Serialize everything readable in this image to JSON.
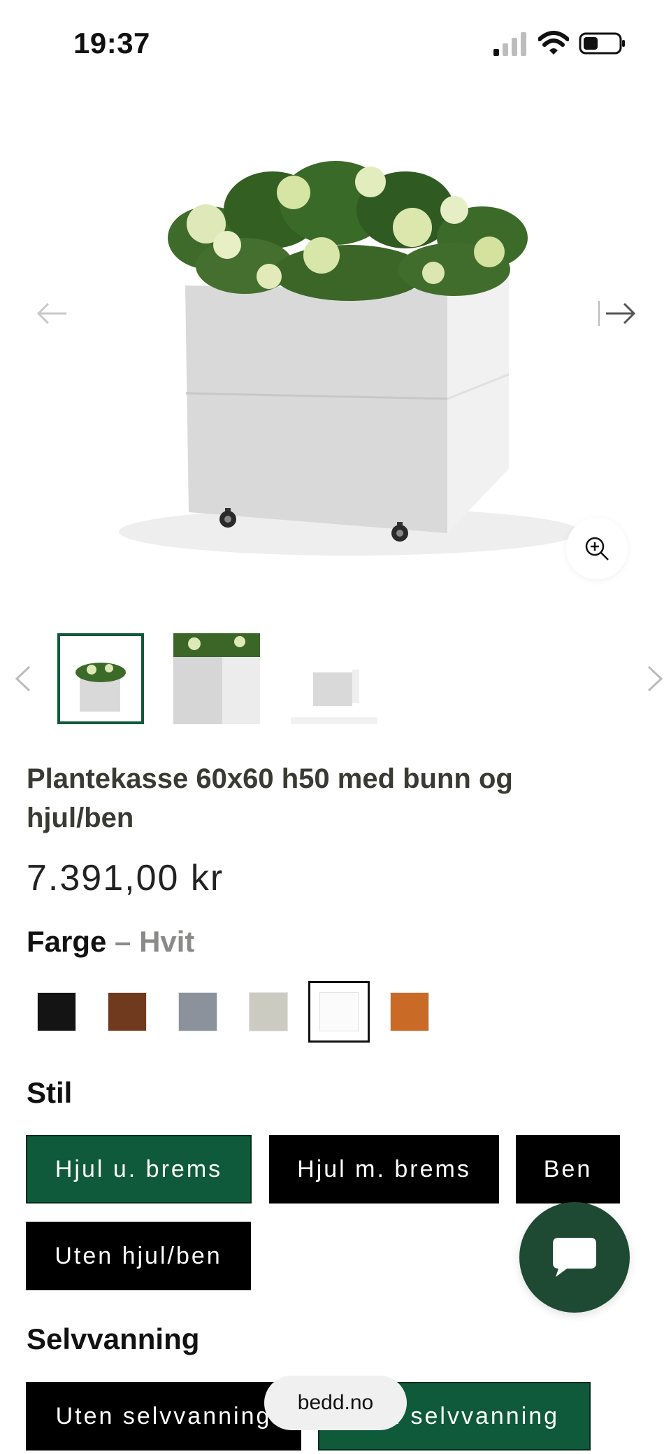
{
  "status_bar": {
    "time": "19:37",
    "signal_icon": "cellular-signal-icon",
    "wifi_icon": "wifi-icon",
    "battery_icon": "battery-icon"
  },
  "gallery": {
    "prev_icon": "arrow-left-icon",
    "next_icon": "arrow-right-icon",
    "zoom_icon": "zoom-in-icon",
    "image": "white planter box on wheels with hydrangea plants",
    "thumbnails_count": 3
  },
  "product": {
    "title": "Plantekasse 60x60 h50 med bunn og hjul/ben",
    "price": "7.391,00 kr"
  },
  "farge": {
    "label": "Farge",
    "separator": " – ",
    "selected": "Hvit",
    "swatches": [
      "#141414",
      "#6f3a1e",
      "#8c929b",
      "#cccbc1",
      "#fbfbfb",
      "#c96b26"
    ]
  },
  "stil": {
    "label": "Stil",
    "options": [
      "Hjul u. brems",
      "Hjul m. brems",
      "Ben",
      "Uten hjul/ben"
    ],
    "selected": "Hjul u. brems"
  },
  "selvvanning": {
    "label": "Selvvanning",
    "options": [
      "Uten selvvanning",
      "Med selvvanning"
    ],
    "selected": "Med selvvanning"
  },
  "chat": {
    "icon": "chat-bubble-icon"
  },
  "browser": {
    "domain": "bedd.no"
  },
  "colors": {
    "accent": "#0f5a3a",
    "chat": "#1e4a33"
  }
}
